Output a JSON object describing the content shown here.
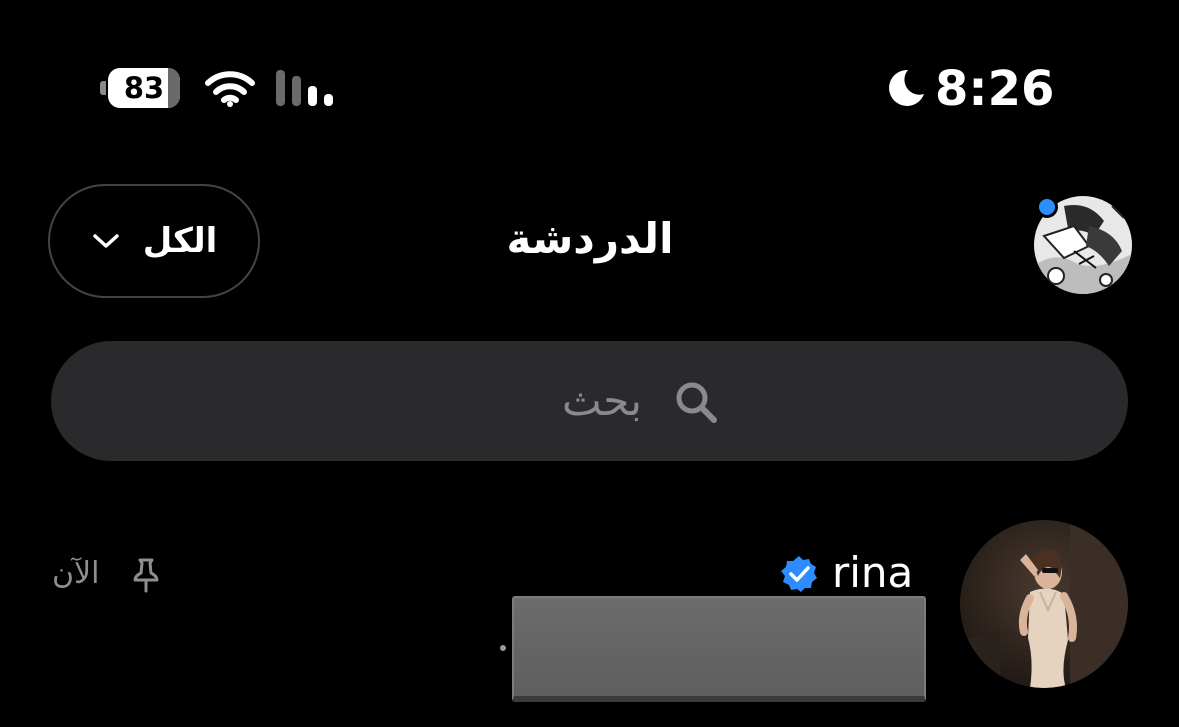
{
  "status_bar": {
    "battery_level": "83",
    "battery_fraction": 0.83,
    "time": "8:26",
    "focus_icon": "moon-icon",
    "wifi_icon": "wifi-icon",
    "cellular_icon": "cellular-signal-icon"
  },
  "header": {
    "title": "الدردشة",
    "filter_label": "الكل",
    "filter_icon": "chevron-down-icon",
    "profile_avatar": "profile-avatar",
    "notification_dot_color": "#2d8cff"
  },
  "search": {
    "placeholder": "بحث",
    "icon": "search-icon"
  },
  "chats": [
    {
      "name": "rina",
      "verified": true,
      "verified_color": "#2d8cff",
      "pinned": true,
      "time": "الآن",
      "preview_redacted": true
    }
  ],
  "colors": {
    "background": "#000000",
    "search_background": "#2a2a2c",
    "muted_text": "#8e8e93",
    "accent": "#2d8cff"
  }
}
